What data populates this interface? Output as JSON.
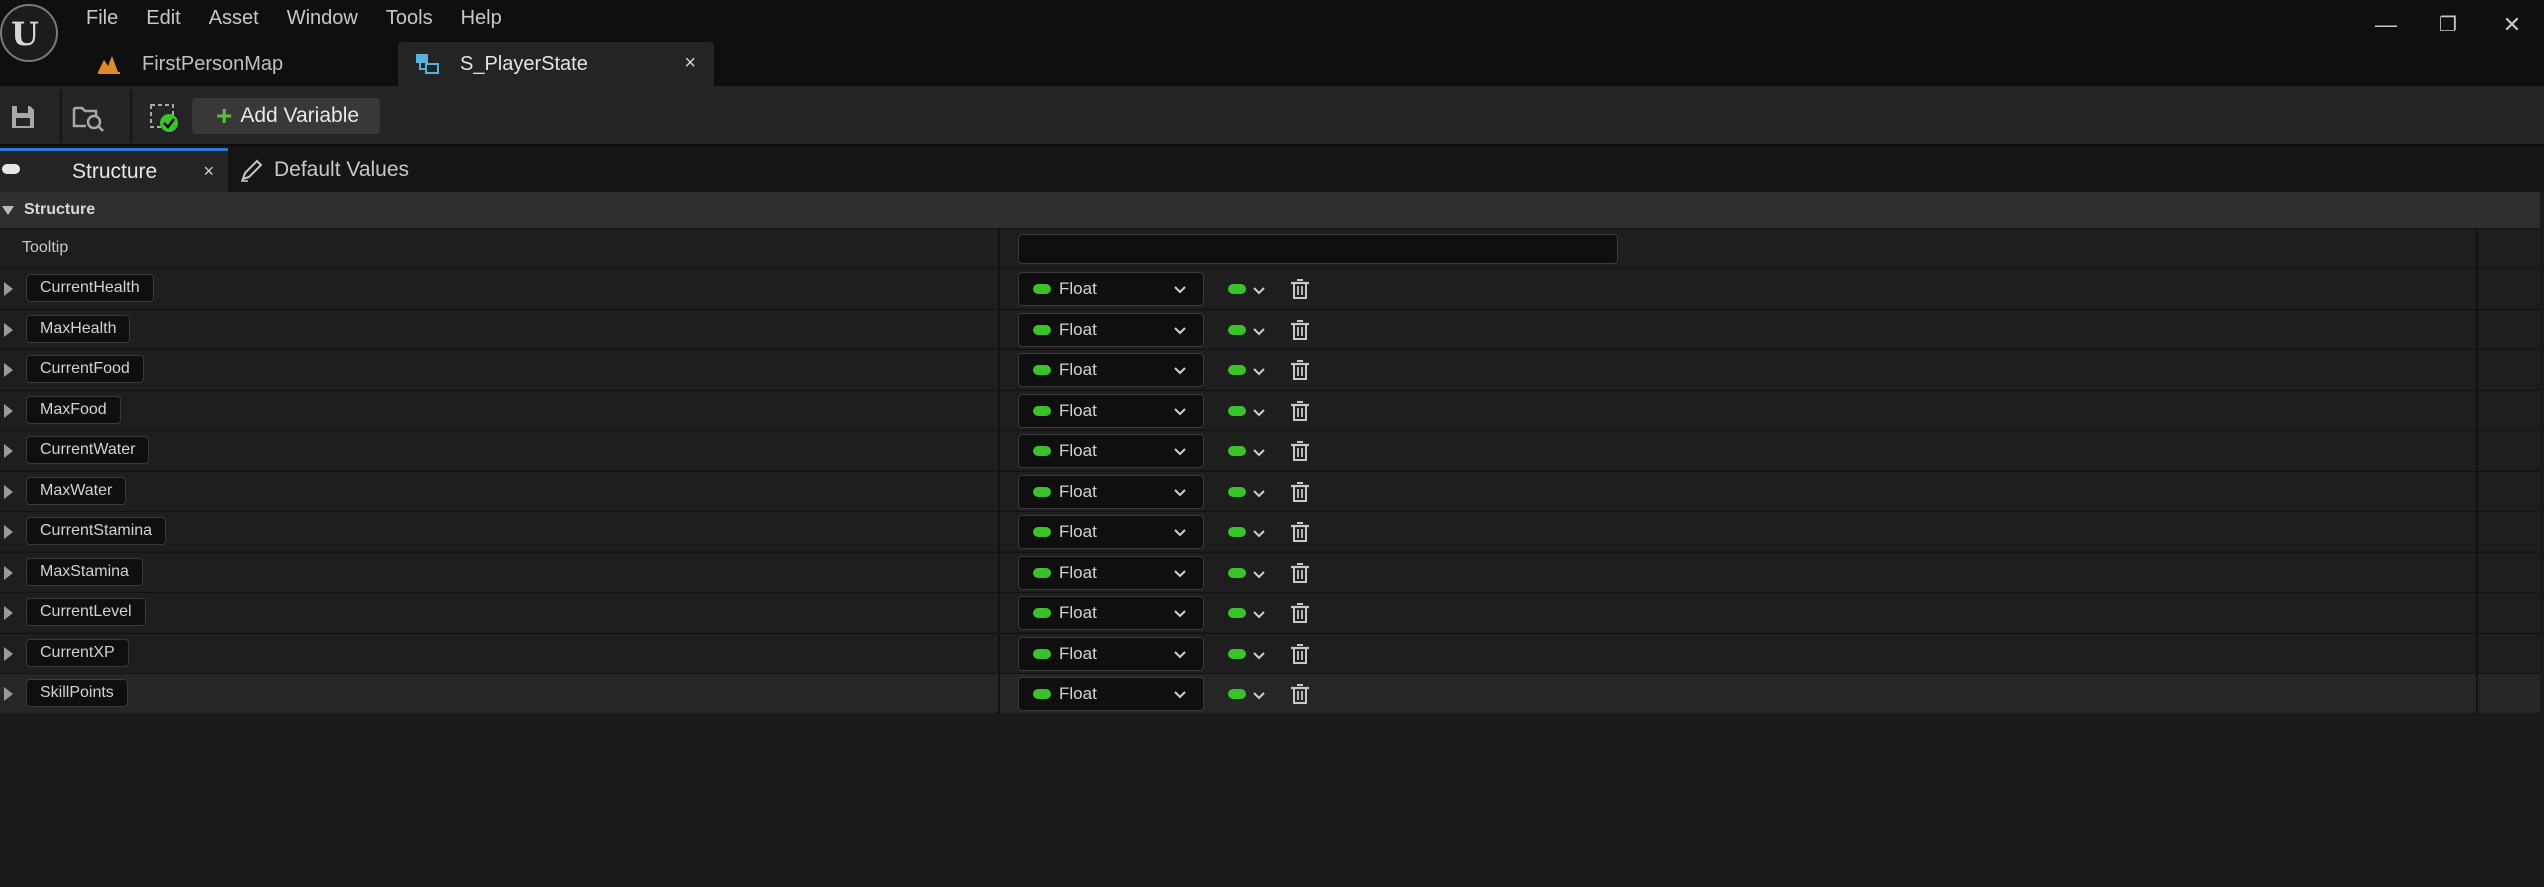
{
  "app": {
    "logo_letter": "U",
    "menu": [
      "File",
      "Edit",
      "Asset",
      "Window",
      "Tools",
      "Help"
    ],
    "window_controls": {
      "minimize": "—",
      "restore": "❐",
      "close": "✕"
    }
  },
  "doc_tabs": [
    {
      "label": "FirstPersonMap",
      "icon": "level-map-icon",
      "active": false
    },
    {
      "label": "S_PlayerState",
      "icon": "struct-icon",
      "active": true,
      "close": "×"
    }
  ],
  "toolbar": {
    "save_icon": "save-icon",
    "browse_icon": "browse-asset-icon",
    "validate_icon": "validate-icon",
    "add_variable_plus": "+",
    "add_variable_label": "Add Variable"
  },
  "panel_tabs": [
    {
      "label": "Structure",
      "active": true,
      "close": "×"
    },
    {
      "label": "Default Values",
      "active": false
    }
  ],
  "structure": {
    "category": "Structure",
    "tooltip_label": "Tooltip",
    "tooltip_value": "",
    "variables": [
      {
        "name": "CurrentHealth",
        "type": "Float"
      },
      {
        "name": "MaxHealth",
        "type": "Float"
      },
      {
        "name": "CurrentFood",
        "type": "Float"
      },
      {
        "name": "MaxFood",
        "type": "Float"
      },
      {
        "name": "CurrentWater",
        "type": "Float"
      },
      {
        "name": "MaxWater",
        "type": "Float"
      },
      {
        "name": "CurrentStamina",
        "type": "Float"
      },
      {
        "name": "MaxStamina",
        "type": "Float"
      },
      {
        "name": "CurrentLevel",
        "type": "Float"
      },
      {
        "name": "CurrentXP",
        "type": "Float"
      },
      {
        "name": "SkillPoints",
        "type": "Float"
      }
    ]
  },
  "colors": {
    "accent_blue": "#2b78d8",
    "float_pin_green": "#39c22a",
    "add_plus_green": "#5fbf3a",
    "map_icon_orange": "#e08a2a",
    "struct_icon_cyan": "#5ab0d8"
  }
}
